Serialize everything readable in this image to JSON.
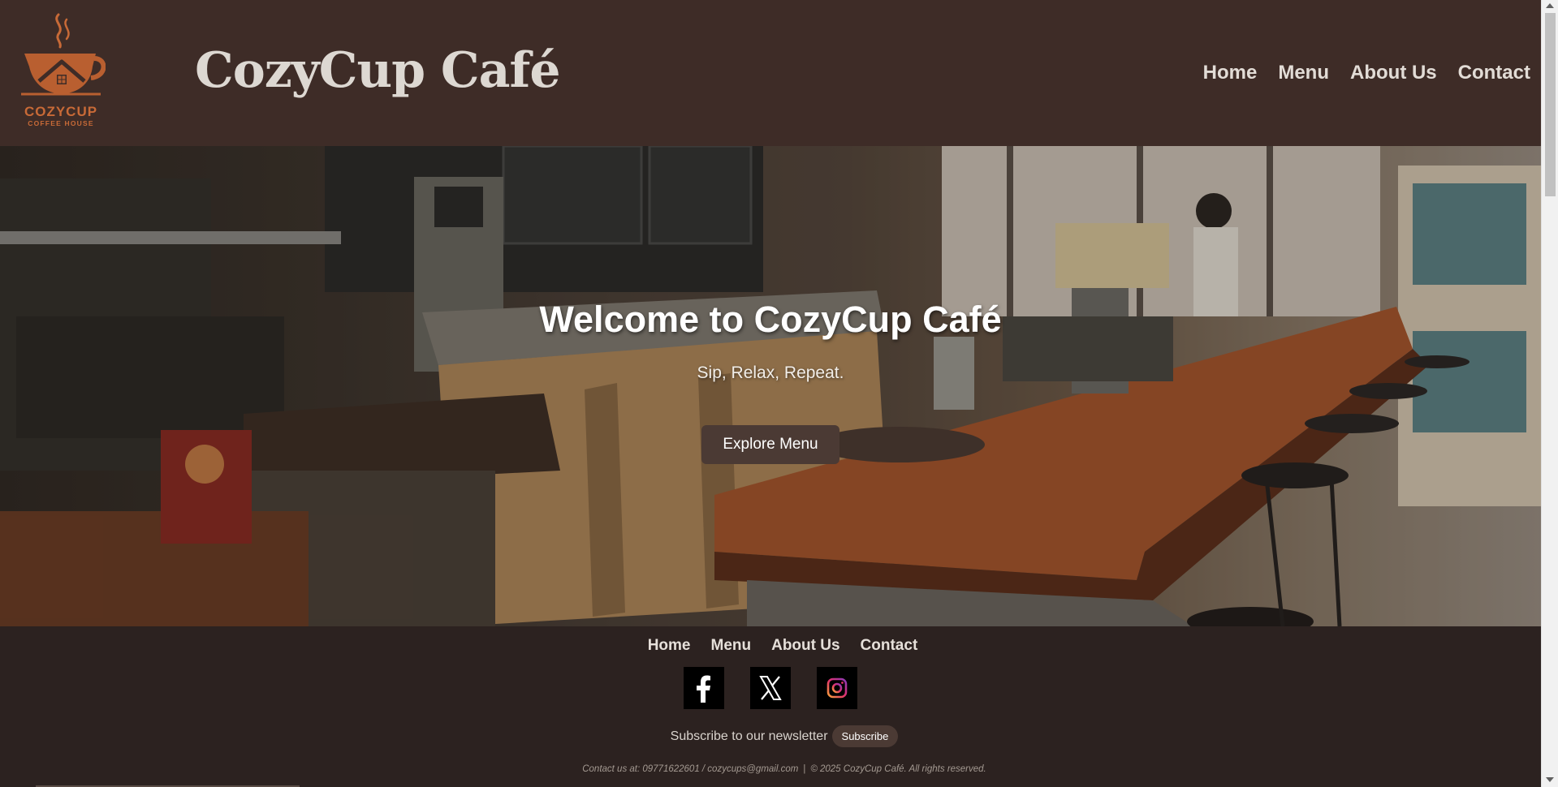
{
  "header": {
    "logo": {
      "name": "COZYCUP",
      "subtitle": "COFFEE HOUSE"
    },
    "title": "CozyCup Café",
    "nav": [
      {
        "label": "Home"
      },
      {
        "label": "Menu"
      },
      {
        "label": "About Us"
      },
      {
        "label": "Contact"
      }
    ]
  },
  "hero": {
    "title": "Welcome to CozyCup Café",
    "subtitle": "Sip, Relax, Repeat.",
    "button_label": "Explore Menu"
  },
  "footer": {
    "nav": [
      {
        "label": "Home"
      },
      {
        "label": "Menu"
      },
      {
        "label": "About Us"
      },
      {
        "label": "Contact"
      }
    ],
    "socials": [
      {
        "icon": "facebook-icon"
      },
      {
        "icon": "x-icon"
      },
      {
        "icon": "instagram-icon"
      }
    ],
    "newsletter_text": "Subscribe to our newsletter",
    "subscribe_label": "Subscribe",
    "contact": "Contact us at: 09771622601 / cozycups@gmail.com",
    "copyright": "© 2025 CozyCup Café. All rights reserved."
  },
  "colors": {
    "header_bg": "#3e2c27",
    "footer_bg": "#2c2220",
    "button_bg": "#4b3a34",
    "logo_accent": "#c86a37"
  }
}
